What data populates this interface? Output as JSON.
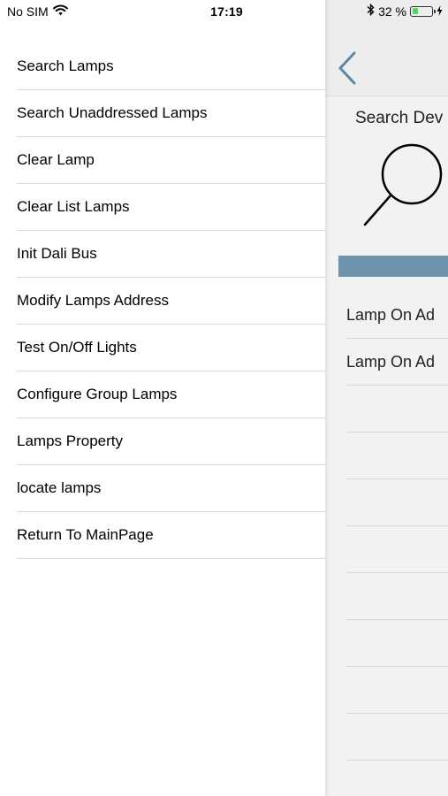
{
  "status_bar": {
    "carrier": "No SIM",
    "time": "17:19",
    "battery_percent": "32 %",
    "battery_level": 0.32,
    "icons": [
      "wifi-icon",
      "bluetooth-icon",
      "battery-icon",
      "charging-icon"
    ]
  },
  "menu": {
    "items": [
      "Search Lamps",
      "Search Unaddressed Lamps",
      "Clear Lamp",
      "Clear List Lamps",
      "Init Dali Bus",
      "Modify Lamps Address",
      "Test On/Off Lights",
      "Configure Group Lamps",
      "Lamps Property",
      "locate lamps",
      "Return To MainPage"
    ]
  },
  "background_page": {
    "back_icon": "chevron-left-icon",
    "search_title": "Search Dev",
    "search_icon": "magnifier-icon",
    "results": [
      "Lamp On Ad",
      "Lamp On Ad",
      "",
      "",
      "",
      "",
      "",
      "",
      "",
      "",
      ""
    ],
    "colors": {
      "accent": "#6e93ad",
      "back_chevron": "#5b87a8"
    }
  }
}
